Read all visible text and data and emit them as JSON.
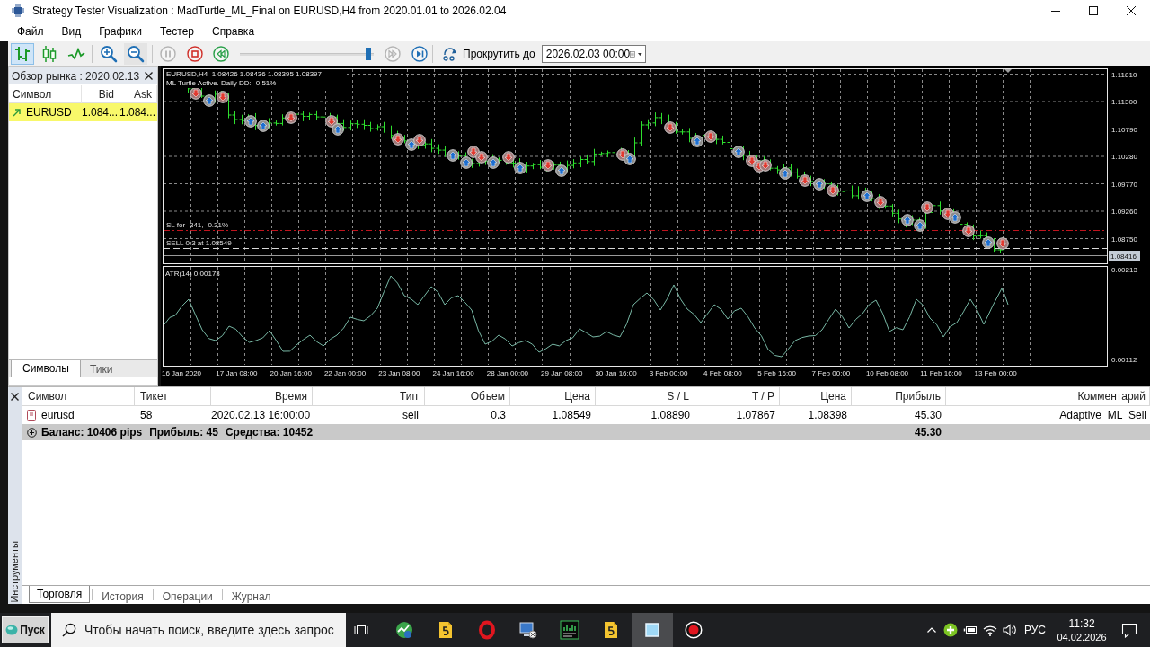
{
  "window": {
    "title": "Strategy Tester Visualization : MadTurtle_ML_Final on EURUSD,H4 from 2020.01.01 to 2026.02.04"
  },
  "menu": [
    "Файл",
    "Вид",
    "Графики",
    "Тестер",
    "Справка"
  ],
  "toolbar": {
    "chart_types": [
      {
        "selected": true
      },
      {
        "selected": false
      },
      {
        "selected": false
      }
    ],
    "playback": [
      {
        "disabled": true
      },
      {
        "disabled": false
      },
      {
        "disabled": false
      }
    ],
    "speed_slider": {
      "level": 0.98
    },
    "step_buttons": [
      {
        "disabled": true
      },
      {
        "disabled": false
      }
    ],
    "scroll_label": "Прокрутить до",
    "scroll_date": "2026.02.03 00:00"
  },
  "market_watch": {
    "title": "Обзор рынка : 2020.02.13",
    "columns": [
      "Символ",
      "Bid",
      "Ask"
    ],
    "rows": [
      {
        "symbol": "EURUSD",
        "bid": "1.084...",
        "ask": "1.084...",
        "selected": true
      }
    ],
    "tabs": [
      {
        "label": "Символы",
        "selected": true
      },
      {
        "label": "Тики",
        "selected": false
      }
    ]
  },
  "chart": {
    "header": "EURUSD,H4  1.08426 1.08436 1.08395 1.08397",
    "status": "ML Turtle Active. Daily DD: -0.51%",
    "order_lines": [
      {
        "kind": "stop",
        "label": "SL for -341, -0.31%"
      },
      {
        "kind": "entry",
        "label": "SELL 0.3 at 1.08549"
      }
    ],
    "price_ticks": [
      "1.11810",
      "1.11300",
      "1.10790",
      "1.10280",
      "1.09770",
      "1.09260",
      "1.08750"
    ],
    "current_price": "1.08416",
    "indicator": {
      "label": "ATR(14) 0.00173",
      "ticks": [
        "0.00213",
        "0.00112"
      ]
    },
    "time_labels": [
      "16 Jan 2020",
      "17 Jan 08:00",
      "20 Jan 16:00",
      "22 Jan 00:00",
      "23 Jan 08:00",
      "24 Jan 16:00",
      "28 Jan 00:00",
      "29 Jan 08:00",
      "30 Jan 16:00",
      "3 Feb 00:00",
      "4 Feb 08:00",
      "5 Feb 16:00",
      "7 Feb 00:00",
      "10 Feb 08:00",
      "11 Feb 16:00",
      "13 Feb 00:00"
    ]
  },
  "terminal": {
    "side_label": "Инструменты",
    "columns": [
      "Символ",
      "Тикет",
      "Время",
      "Тип",
      "Объем",
      "Цена",
      "S / L",
      "T / P",
      "Цена",
      "Прибыль",
      "Комментарий"
    ],
    "rows": [
      {
        "cells": [
          "eurusd",
          "58",
          "2020.02.13 16:00:00",
          "sell",
          "0.3",
          "1.08549",
          "1.08890",
          "1.07867",
          "1.08398",
          "45.30",
          "Adaptive_ML_Sell"
        ]
      }
    ],
    "summary": {
      "balance": "Баланс: 10406 pips",
      "profit": "Прибыль: 45",
      "equity": "Средства: 10452",
      "total": "45.30"
    },
    "tabs": [
      {
        "label": "Торговля",
        "selected": true
      },
      {
        "label": "История",
        "selected": false
      },
      {
        "label": "Операции",
        "selected": false
      },
      {
        "label": "Журнал",
        "selected": false
      }
    ]
  },
  "taskbar": {
    "start": "Пуск",
    "search": {
      "placeholder": "Чтобы начать поиск, введите здесь запрос"
    },
    "apps": [
      {
        "selected": false
      },
      {
        "selected": false
      },
      {
        "selected": false
      },
      {
        "selected": false
      },
      {
        "selected": false
      },
      {
        "selected": false
      },
      {
        "selected": true
      },
      {
        "selected": false
      }
    ],
    "language": "РУС",
    "time": "11:32",
    "date": "04.02.2026"
  }
}
